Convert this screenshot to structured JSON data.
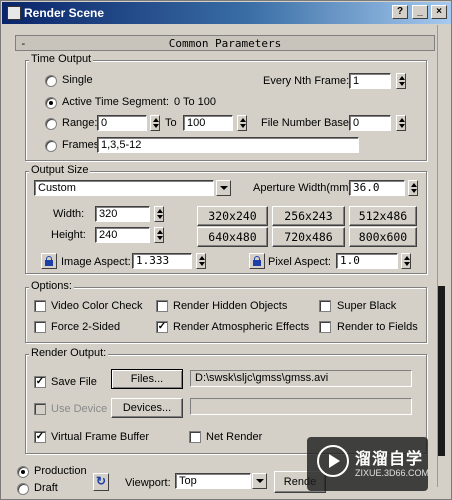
{
  "window": {
    "title": "Render Scene",
    "controls": [
      "?",
      "_",
      "×"
    ]
  },
  "rollout": {
    "minus": "-",
    "title": "Common Parameters"
  },
  "time_output": {
    "label": "Time Output",
    "single": "Single",
    "active_segment": "Active Time Segment:",
    "active_range_text": "0 To 100",
    "range": "Range:",
    "range_from": "0",
    "range_to_label": "To",
    "range_to": "100",
    "frames": "Frames",
    "frames_value": "1,3,5-12",
    "every_nth_label": "Every Nth Frame:",
    "every_nth_value": "1",
    "file_number_base_label": "File Number Base:",
    "file_number_base_value": "0",
    "selected": "active_segment"
  },
  "output_size": {
    "label": "Output Size",
    "preset": "Custom",
    "aperture_label": "Aperture Width(mm):",
    "aperture_value": "36.0",
    "width_label": "Width:",
    "width_value": "320",
    "height_label": "Height:",
    "height_value": "240",
    "presets": [
      "320x240",
      "256x243",
      "512x486",
      "640x480",
      "720x486",
      "800x600"
    ],
    "image_aspect_label": "Image Aspect:",
    "image_aspect_value": "1.333",
    "pixel_aspect_label": "Pixel Aspect:",
    "pixel_aspect_value": "1.0"
  },
  "options": {
    "label": "Options:",
    "video_color_check": "Video Color Check",
    "render_hidden": "Render Hidden Objects",
    "super_black": "Super Black",
    "force_2_sided": "Force 2-Sided",
    "render_atmospheric": "Render Atmospheric Effects",
    "render_to_fields": "Render to Fields",
    "render_atmospheric_checked": true
  },
  "render_output": {
    "label": "Render Output:",
    "save_file": "Save File",
    "save_file_checked": true,
    "files_button": "Files...",
    "file_path": "D:\\swsk\\sljc\\gmss\\gmss.avi",
    "use_device": "Use Device",
    "devices_button": "Devices...",
    "virtual_frame_buffer": "Virtual Frame Buffer",
    "virtual_frame_buffer_checked": true,
    "net_render": "Net Render",
    "check_mark": "✓"
  },
  "bottom": {
    "production": "Production",
    "draft": "Draft",
    "viewport_label": "Viewport:",
    "viewport_value": "Top",
    "render_button": "Rende",
    "selected_mode": "production"
  },
  "watermark": {
    "brand": "溜溜自学",
    "url": "ZIXUE.3D66.COM"
  }
}
